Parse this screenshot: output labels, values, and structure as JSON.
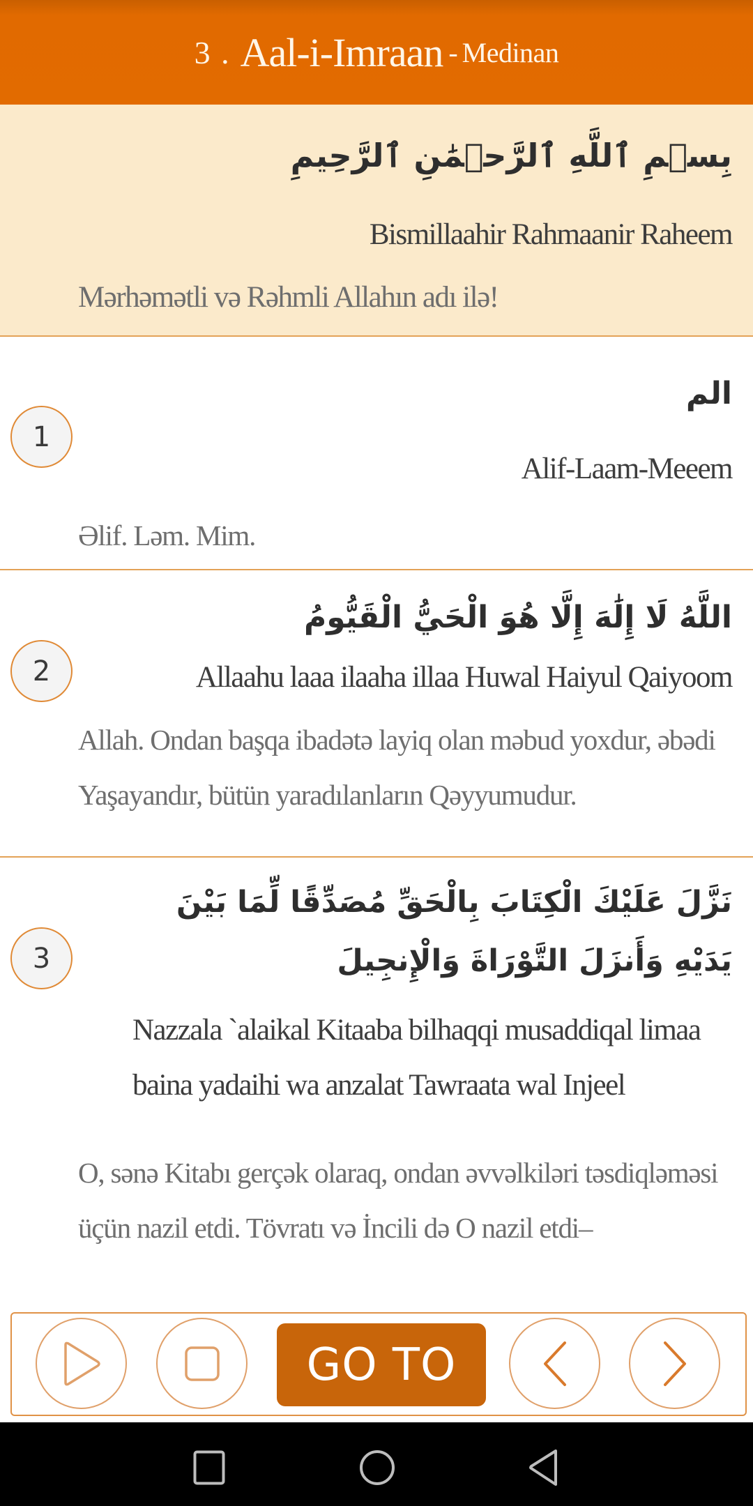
{
  "header": {
    "surah_number": "3 .",
    "surah_name": "Aal-i-Imraan",
    "separator": "-",
    "revelation_type": "Medinan"
  },
  "bismillah": {
    "arabic": "بِسۡمِ ٱللَّهِ ٱلرَّحۡمَٰنِ ٱلرَّحِيمِ",
    "transliteration": "Bismillaahir Rahmaanir Raheem",
    "translation": "Mərhəmətli və Rəhmli Allahın adı ilə!"
  },
  "verses": [
    {
      "number": "1",
      "arabic": "الم",
      "transliteration": "Alif-Laam-Meeem",
      "translation": "Əlif. Ləm. Mim."
    },
    {
      "number": "2",
      "arabic": "اللَّهُ لَا إِلَٰهَ إِلَّا هُوَ الْحَيُّ الْقَيُّومُ",
      "transliteration": "Allaahu laaa ilaaha illaa Huwal Haiyul Qaiyoom",
      "translation": "Allah. Ondan başqa ibadətə layiq olan məbud yoxdur, əbədi Yaşayandır, bütün yaradılanların Qəyyumudur."
    },
    {
      "number": "3",
      "arabic": "نَزَّلَ عَلَيْكَ الْكِتَابَ بِالْحَقِّ مُصَدِّقًا لِّمَا بَيْنَ يَدَيْهِ وَأَنزَلَ التَّوْرَاةَ وَالْإِنجِيلَ",
      "transliteration": "Nazzala `alaikal Kitaaba bilhaqqi musaddiqal limaa baina yadaihi wa anzalat Tawraata wal Injeel",
      "translation": "O, sənə Kitabı gerçək olaraq, ondan əvvəlkiləri təsdiqləməsi üçün nazil etdi. Tövratı və İncili də O nazil etdi–"
    }
  ],
  "toolbar": {
    "play_icon": "play-icon",
    "stop_icon": "stop-icon",
    "goto_label": "GO TO",
    "prev_icon": "chevron-left-icon",
    "next_icon": "chevron-right-icon"
  },
  "nav_bar": {
    "recents_icon": "square-icon",
    "home_icon": "circle-icon",
    "back_icon": "triangle-back-icon"
  },
  "colors": {
    "header_bg": "#E26B00",
    "header_text": "#FFF6E8",
    "bismillah_bg": "#FBEACB",
    "accent_border": "#E3A257",
    "goto_bg": "#C8650A",
    "badge_bg": "#F4F4F4",
    "navbar_bg": "#000000"
  }
}
